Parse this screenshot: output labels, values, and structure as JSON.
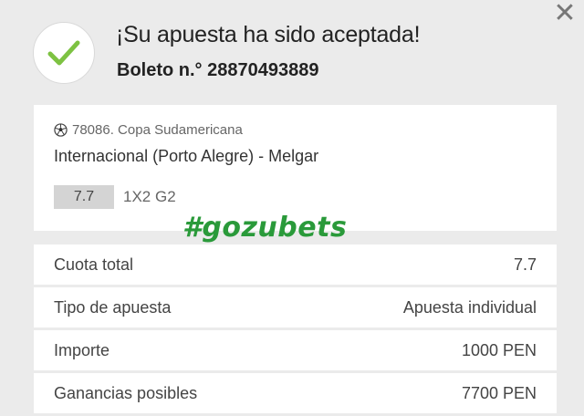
{
  "header": {
    "title": "¡Su apuesta ha sido aceptada!",
    "ticket": "Boleto n.° 28870493889"
  },
  "event": {
    "league": "78086. Copa Sudamericana",
    "match": "Internacional (Porto Alegre) - Melgar",
    "odd": "7.7",
    "market": "1X2 G2"
  },
  "watermark": "#gozubets",
  "summary": [
    {
      "label": "Cuota total",
      "value": "7.7"
    },
    {
      "label": "Tipo de apuesta",
      "value": "Apuesta individual"
    },
    {
      "label": "Importe",
      "value": "1000 PEN"
    },
    {
      "label": "Ganancias posibles",
      "value": "7700 PEN"
    }
  ],
  "colors": {
    "background": "#ebebeb",
    "check": "#7dc242",
    "watermark": "#2a9a3a"
  },
  "icons": {
    "close": "close-icon",
    "success": "checkmark-icon",
    "sport": "soccer-ball-icon"
  }
}
